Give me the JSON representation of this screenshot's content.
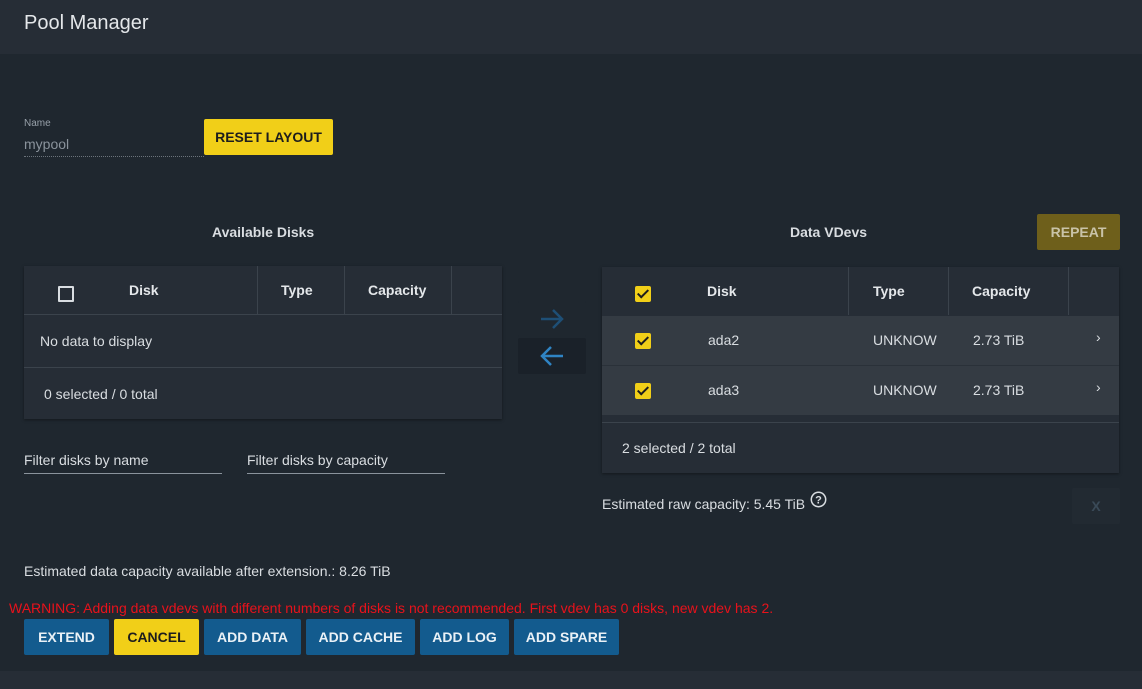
{
  "header": {
    "title": "Pool Manager"
  },
  "name_field": {
    "label": "Name",
    "value": "mypool"
  },
  "reset_layout_label": "RESET LAYOUT",
  "available": {
    "title": "Available Disks",
    "columns": [
      "Disk",
      "Type",
      "Capacity"
    ],
    "empty_message": "No data to display",
    "footer": "0 selected / 0 total",
    "filter_name_placeholder": "Filter disks by name",
    "filter_capacity_placeholder": "Filter disks by capacity"
  },
  "vdevs": {
    "title": "Data VDevs",
    "repeat_label": "REPEAT",
    "columns": [
      "Disk",
      "Type",
      "Capacity"
    ],
    "rows": [
      {
        "disk": "ada2",
        "type": "UNKNOW",
        "capacity": "2.73 TiB",
        "selected": true
      },
      {
        "disk": "ada3",
        "type": "UNKNOW",
        "capacity": "2.73 TiB",
        "selected": true
      }
    ],
    "footer": "2 selected / 2 total",
    "raw_capacity": "Estimated raw capacity: 5.45 TiB",
    "remove_label": "X"
  },
  "estimated_capacity": "Estimated data capacity available after extension.: 8.26 TiB",
  "warning": "WARNING: Adding data vdevs with different numbers of disks is not recommended. First vdev has 0 disks, new vdev has 2.",
  "actions": {
    "extend": "EXTEND",
    "cancel": "CANCEL",
    "add_data": "ADD DATA",
    "add_cache": "ADD CACHE",
    "add_log": "ADD LOG",
    "add_spare": "ADD SPARE"
  },
  "colors": {
    "background": "#1f272f",
    "panel": "#262d36",
    "accent_yellow": "#f1cf18",
    "primary_blue": "#135b8e",
    "warning_red": "#e8121b"
  },
  "icons": [
    "arrow-right-icon",
    "arrow-left-icon",
    "chevron-right-icon",
    "help-circle-icon",
    "checkbox-icon"
  ]
}
